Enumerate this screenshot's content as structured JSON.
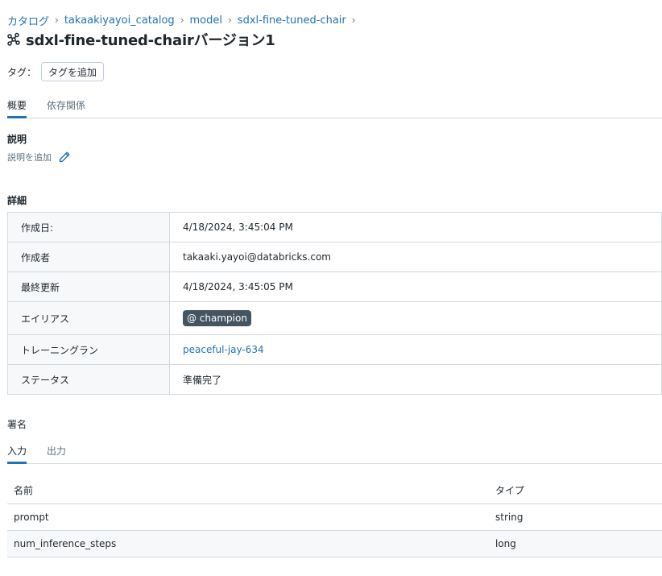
{
  "breadcrumb": {
    "items": [
      "カタログ",
      "takaakiyayoi_catalog",
      "model",
      "sdxl-fine-tuned-chair"
    ],
    "separator": "›"
  },
  "title": {
    "icon": "model-icon",
    "text": "sdxl-fine-tuned-chairバージョン1"
  },
  "tags": {
    "label": "タグ：",
    "add_button": "タグを追加"
  },
  "main_tabs": [
    {
      "label": "概要",
      "active": true
    },
    {
      "label": "依存関係",
      "active": false
    }
  ],
  "description": {
    "title": "説明",
    "placeholder": "説明を追加",
    "edit_icon": "pencil-icon"
  },
  "details": {
    "title": "詳細",
    "rows": {
      "created_label": "作成日:",
      "created_value": "4/18/2024, 3:45:04 PM",
      "creator_label": "作成者",
      "creator_value": "takaaki.yayoi@databricks.com",
      "updated_label": "最終更新",
      "updated_value": "4/18/2024, 3:45:05 PM",
      "alias_label": "エイリアス",
      "alias_value": "@ champion",
      "run_label": "トレーニングラン",
      "run_value": "peaceful-jay-634",
      "status_label": "ステータス",
      "status_value": "準備完了"
    }
  },
  "signature": {
    "title": "署名",
    "tabs": [
      {
        "label": "入力",
        "active": true
      },
      {
        "label": "出力",
        "active": false
      }
    ],
    "columns": [
      "名前",
      "タイプ"
    ],
    "rows": [
      [
        "prompt",
        "string"
      ],
      [
        "num_inference_steps",
        "long"
      ]
    ]
  },
  "colors": {
    "link": "#2272b4",
    "badge_bg": "#445461",
    "border": "#d1d9e1"
  }
}
